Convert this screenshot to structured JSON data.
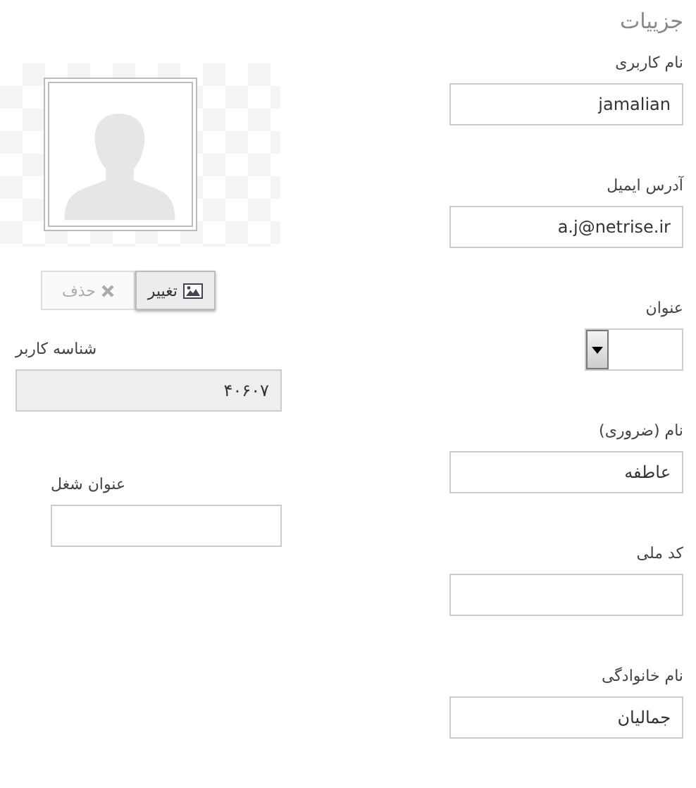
{
  "title": "جزییات",
  "fields": [
    {
      "label": "نام کاربری",
      "value": "jamalian",
      "kind": "text"
    },
    {
      "label": "آدرس ایمیل",
      "value": "a.j@netrise.ir",
      "kind": "text"
    },
    {
      "label": "عنوان",
      "kind": "select"
    },
    {
      "label": "نام (ضروری)",
      "value": "عاطفه",
      "kind": "text"
    },
    {
      "label": "کد ملی",
      "kind": "text"
    },
    {
      "label": "نام خانوادگی",
      "value": "جمالیان",
      "kind": "text"
    }
  ],
  "photo": {
    "buttons": [
      {
        "label": "تغییر",
        "kind": "change",
        "disabled": false
      },
      {
        "label": "حذف",
        "kind": "delete",
        "disabled": true
      }
    ]
  },
  "user_id": {
    "label": "شناسه کاربر",
    "value": "۴۰۶۰۷",
    "readonly": true
  },
  "job_title": {
    "label": "عنوان شغل"
  }
}
